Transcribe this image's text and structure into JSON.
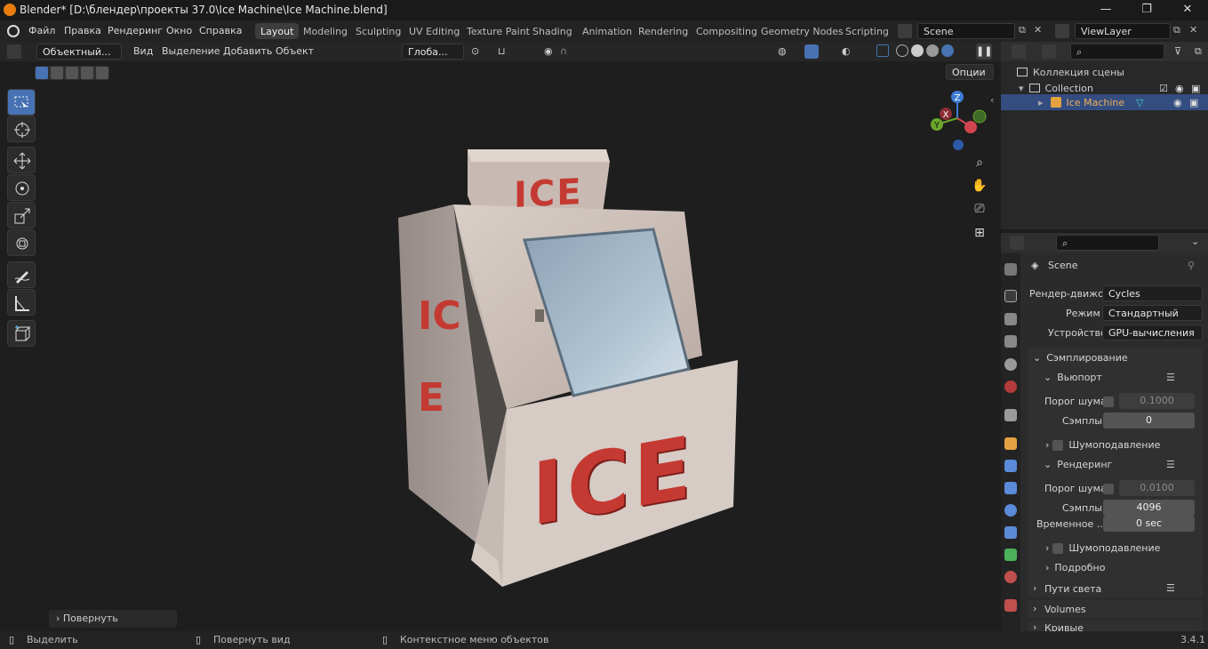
{
  "window": {
    "title": "Blender* [D:\\блендер\\проекты 37.0\\Ice Machine\\Ice Machine.blend]",
    "min": "—",
    "max": "❐",
    "close": "✕"
  },
  "menus": [
    "Файл",
    "Правка",
    "Рендеринг",
    "Окно",
    "Справка"
  ],
  "workspaces": [
    "Layout",
    "Modeling",
    "Sculpting",
    "UV Editing",
    "Texture Paint",
    "Shading",
    "Animation",
    "Rendering",
    "Compositing",
    "Geometry Nodes",
    "Scripting"
  ],
  "scene": {
    "name": "Scene",
    "viewlayer": "ViewLayer"
  },
  "viewport_header": {
    "mode": "Объектный...",
    "menus": [
      "Вид",
      "Выделение",
      "Добавить",
      "Объект"
    ],
    "transform": "Глоба...",
    "options": "Опции"
  },
  "viewport": {
    "ice_top": "ICE",
    "ice_front": "ICE",
    "ice_side": "ICE",
    "gizmo": {
      "x": "X",
      "y": "Y",
      "z": "Z"
    },
    "operator_panel": "Повернуть"
  },
  "outliner": {
    "root": "Коллекция сцены",
    "collection": "Collection",
    "object": "Ice Machine"
  },
  "properties": {
    "context": "Scene",
    "render_engine_label": "Рендер-движок",
    "render_engine": "Cycles",
    "mode_label": "Режим",
    "mode": "Стандартный",
    "device_label": "Устройство",
    "device": "GPU-вычисления",
    "sampling": "Сэмплирование",
    "viewport": "Вьюпорт",
    "noise_threshold_label": "Порог шума",
    "viewport_noise_threshold": "0.1000",
    "samples_label": "Сэмплы",
    "viewport_samples": "0",
    "denoise": "Шумоподавление",
    "render": "Рендеринг",
    "render_noise_threshold": "0.0100",
    "render_samples": "4096",
    "time_limit_label": "Временное ...",
    "time_limit": "0 sec",
    "denoise2": "Шумоподавление",
    "advanced": "Подробно",
    "light_paths": "Пути света",
    "volumes": "Volumes",
    "curves": "Кривые"
  },
  "status": {
    "select": "Выделить",
    "rotate_view": "Повернуть вид",
    "context_menu": "Контекстное меню объектов",
    "version": "3.4.1"
  },
  "colors": {
    "accent": "#4772b3",
    "selected_row": "#334d80",
    "object_orange": "#e5a042",
    "ice_red": "#c43a32"
  }
}
